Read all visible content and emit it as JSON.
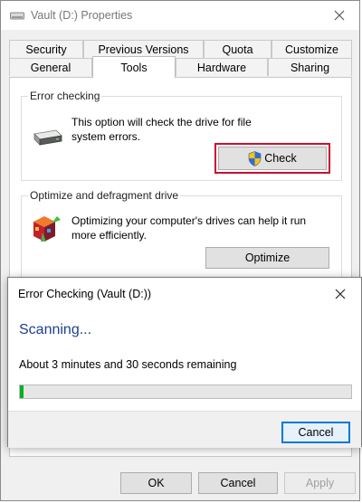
{
  "window": {
    "title": "Vault (D:) Properties"
  },
  "tabs": {
    "row1": [
      "Security",
      "Previous Versions",
      "Quota",
      "Customize"
    ],
    "row2": [
      "General",
      "Tools",
      "Hardware",
      "Sharing"
    ],
    "active": "Tools"
  },
  "error_checking": {
    "title": "Error checking",
    "description_line1": "This option will check the drive for file",
    "description_line2": "system errors.",
    "button_label": "Check"
  },
  "optimize": {
    "title": "Optimize and defragment drive",
    "description_line1": "Optimizing your computer's drives can help it run",
    "description_line2": "more efficiently.",
    "button_label": "Optimize"
  },
  "bottom_buttons": {
    "ok": "OK",
    "cancel": "Cancel",
    "apply": "Apply"
  },
  "dialog": {
    "title": "Error Checking (Vault (D:))",
    "heading": "Scanning...",
    "status": "About 3 minutes and 30 seconds remaining",
    "progress_fraction": 0.01,
    "cancel_label": "Cancel"
  },
  "colors": {
    "highlight_outline": "#c8102e",
    "progress_green": "#06b025",
    "heading_blue": "#1e3f8f",
    "focus_blue": "#0078d7"
  }
}
